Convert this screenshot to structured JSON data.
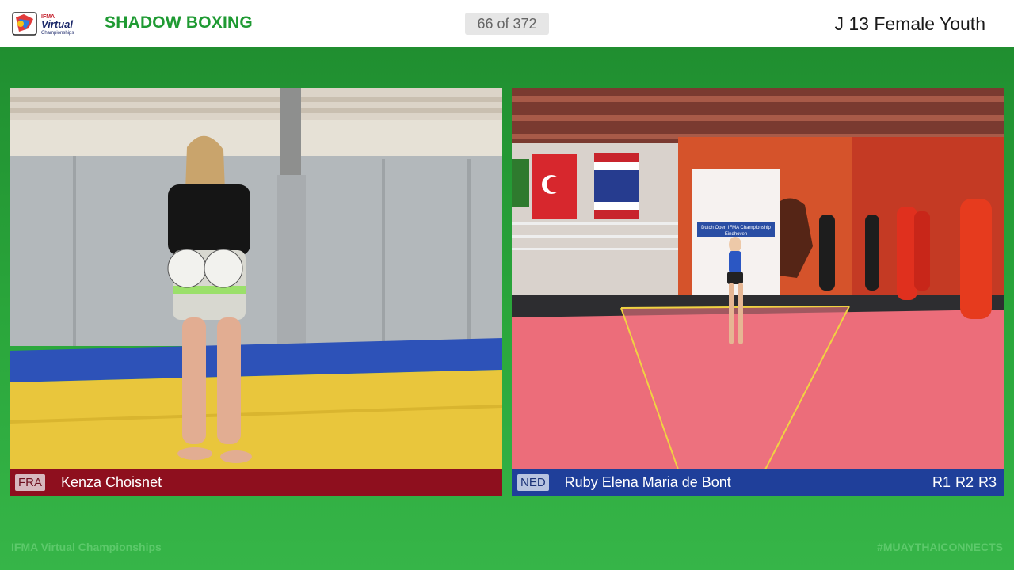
{
  "header": {
    "logo_text": "IFMA Virtual Championships",
    "event_title": "SHADOW BOXING",
    "counter": "66 of 372",
    "category": "J 13 Female Youth"
  },
  "left_athlete": {
    "country_code": "FRA",
    "name": "Kenza Choisnet",
    "corner_color": "#8e0f1e"
  },
  "right_athlete": {
    "country_code": "NED",
    "name": "Ruby Elena Maria de Bont",
    "corner_color": "#1f3f9a",
    "rounds": [
      "R1",
      "R2",
      "R3"
    ]
  },
  "banner_text": {
    "line1": "Dutch Open IFMA Championship",
    "line2": "Eindhoven"
  },
  "footer": {
    "left": "IFMA Virtual Championships",
    "right": "#MUAYTHAICONNECTS"
  },
  "colors": {
    "accent_green": "#1f9a33",
    "background_green": "#2aa63b"
  }
}
